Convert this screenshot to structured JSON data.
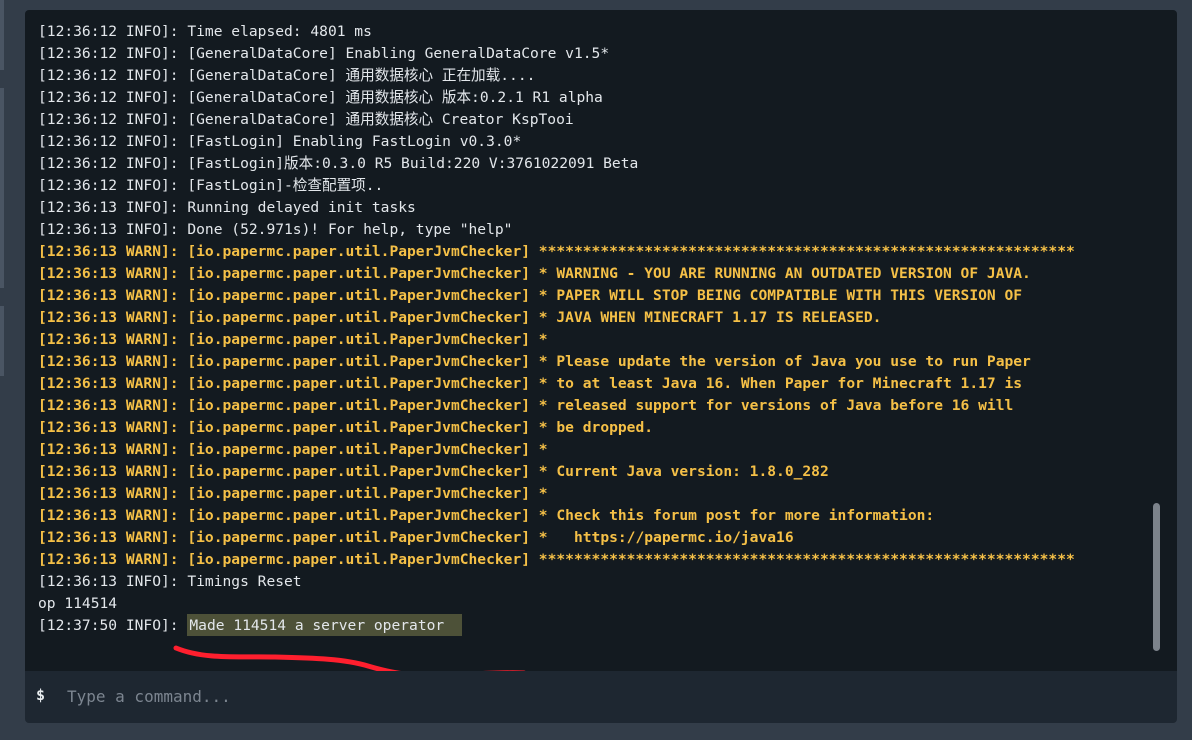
{
  "console": {
    "lines": [
      {
        "level": "info",
        "text": "[12:36:12 INFO]: Time elapsed: 4801 ms"
      },
      {
        "level": "info",
        "text": "[12:36:12 INFO]: [GeneralDataCore] Enabling GeneralDataCore v1.5*"
      },
      {
        "level": "info",
        "text": "[12:36:12 INFO]: [GeneralDataCore] 通用数据核心 正在加载...."
      },
      {
        "level": "info",
        "text": "[12:36:12 INFO]: [GeneralDataCore] 通用数据核心 版本:0.2.1 R1 alpha"
      },
      {
        "level": "info",
        "text": "[12:36:12 INFO]: [GeneralDataCore] 通用数据核心 Creator KspTooi"
      },
      {
        "level": "info",
        "text": "[12:36:12 INFO]: [FastLogin] Enabling FastLogin v0.3.0*"
      },
      {
        "level": "info",
        "text": "[12:36:12 INFO]: [FastLogin]版本:0.3.0 R5 Build:220 V:3761022091 Beta"
      },
      {
        "level": "info",
        "text": "[12:36:12 INFO]: [FastLogin]-检查配置项.."
      },
      {
        "level": "info",
        "text": "[12:36:13 INFO]: Running delayed init tasks"
      },
      {
        "level": "info",
        "text": "[12:36:13 INFO]: Done (52.971s)! For help, type \"help\""
      },
      {
        "level": "warn",
        "text": "[12:36:13 WARN]: [io.papermc.paper.util.PaperJvmChecker] *************************************************************"
      },
      {
        "level": "warn",
        "text": "[12:36:13 WARN]: [io.papermc.paper.util.PaperJvmChecker] * WARNING - YOU ARE RUNNING AN OUTDATED VERSION OF JAVA."
      },
      {
        "level": "warn",
        "text": "[12:36:13 WARN]: [io.papermc.paper.util.PaperJvmChecker] * PAPER WILL STOP BEING COMPATIBLE WITH THIS VERSION OF"
      },
      {
        "level": "warn",
        "text": "[12:36:13 WARN]: [io.papermc.paper.util.PaperJvmChecker] * JAVA WHEN MINECRAFT 1.17 IS RELEASED."
      },
      {
        "level": "warn",
        "text": "[12:36:13 WARN]: [io.papermc.paper.util.PaperJvmChecker] *"
      },
      {
        "level": "warn",
        "text": "[12:36:13 WARN]: [io.papermc.paper.util.PaperJvmChecker] * Please update the version of Java you use to run Paper"
      },
      {
        "level": "warn",
        "text": "[12:36:13 WARN]: [io.papermc.paper.util.PaperJvmChecker] * to at least Java 16. When Paper for Minecraft 1.17 is"
      },
      {
        "level": "warn",
        "text": "[12:36:13 WARN]: [io.papermc.paper.util.PaperJvmChecker] * released support for versions of Java before 16 will"
      },
      {
        "level": "warn",
        "text": "[12:36:13 WARN]: [io.papermc.paper.util.PaperJvmChecker] * be dropped."
      },
      {
        "level": "warn",
        "text": "[12:36:13 WARN]: [io.papermc.paper.util.PaperJvmChecker] *"
      },
      {
        "level": "warn",
        "text": "[12:36:13 WARN]: [io.papermc.paper.util.PaperJvmChecker] * Current Java version: 1.8.0_282"
      },
      {
        "level": "warn",
        "text": "[12:36:13 WARN]: [io.papermc.paper.util.PaperJvmChecker] *"
      },
      {
        "level": "warn",
        "text": "[12:36:13 WARN]: [io.papermc.paper.util.PaperJvmChecker] * Check this forum post for more information:"
      },
      {
        "level": "warn",
        "text": "[12:36:13 WARN]: [io.papermc.paper.util.PaperJvmChecker] *   https://papermc.io/java16"
      },
      {
        "level": "warn",
        "text": "[12:36:13 WARN]: [io.papermc.paper.util.PaperJvmChecker] *************************************************************"
      },
      {
        "level": "info",
        "text": "[12:36:13 INFO]: Timings Reset"
      },
      {
        "level": "input",
        "text": "op 114514"
      }
    ],
    "last_line": {
      "prefix": "[12:37:50 INFO]:",
      "message": "Made 114514 a server operator"
    }
  },
  "command": {
    "prompt": "$",
    "placeholder": "Type a command..."
  },
  "colors": {
    "info_text": "#e3e7eb",
    "warn_text": "#f5c047",
    "console_bg": "#131a20",
    "highlight_bg": "#4d5138",
    "annotation": "#ff1f2e"
  }
}
